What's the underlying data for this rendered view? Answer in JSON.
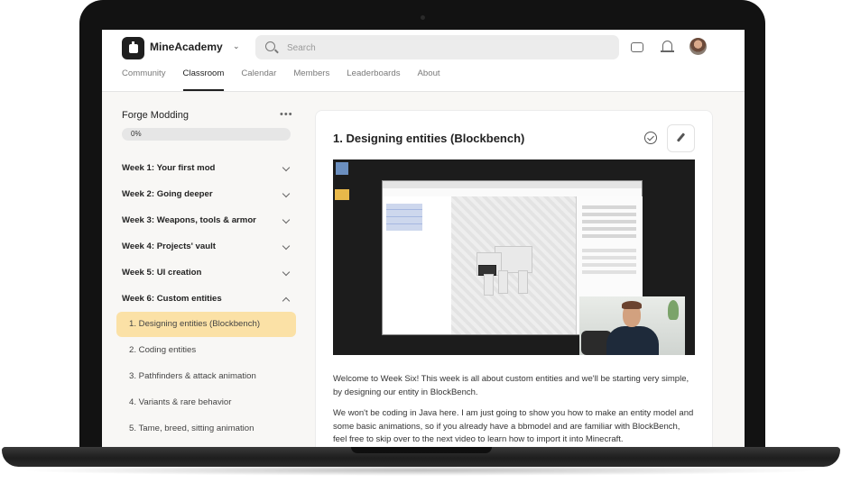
{
  "header": {
    "brand": "MineAcademy",
    "search_placeholder": "Search"
  },
  "tabs": [
    {
      "label": "Community"
    },
    {
      "label": "Classroom"
    },
    {
      "label": "Calendar"
    },
    {
      "label": "Members"
    },
    {
      "label": "Leaderboards"
    },
    {
      "label": "About"
    }
  ],
  "active_tab": "Classroom",
  "sidebar": {
    "course_title": "Forge Modding",
    "progress": {
      "label": "0%",
      "value": 0
    },
    "weeks": [
      {
        "label": "Week 1: Your first mod",
        "expanded": false
      },
      {
        "label": "Week 2: Going deeper",
        "expanded": false
      },
      {
        "label": "Week 3: Weapons, tools & armor",
        "expanded": false
      },
      {
        "label": "Week 4: Projects' vault",
        "expanded": false
      },
      {
        "label": "Week 5: UI creation",
        "expanded": false
      },
      {
        "label": "Week 6: Custom entities",
        "expanded": true
      }
    ],
    "lessons": [
      {
        "label": "1. Designing entities (Blockbench)",
        "active": true
      },
      {
        "label": "2. Coding entities",
        "active": false
      },
      {
        "label": "3. Pathfinders & attack animation",
        "active": false
      },
      {
        "label": "4. Variants & rare behavior",
        "active": false
      },
      {
        "label": "5. Tame, breed, sitting animation",
        "active": false
      }
    ]
  },
  "lesson": {
    "title": "1. Designing entities (Blockbench)",
    "paragraphs": [
      "Welcome to Week Six! This week is all about custom entities and we'll be starting very simple, by designing our entity in BlockBench.",
      "We won't be coding in Java here. I am just going to show you how to make an entity model and some basic animations, so if you already have a bbmodel and are familiar with BlockBench, feel free to skip over to the next video to learn how to import it into Minecraft."
    ]
  },
  "colors": {
    "active_lesson_bg": "#fbe1a6",
    "screen_bg": "#f8f7f5"
  },
  "icons": [
    "logo-icon",
    "chevron-down-icon",
    "search-icon",
    "chat-icon",
    "bell-icon",
    "more-icon",
    "check-circle-icon",
    "pencil-icon"
  ]
}
